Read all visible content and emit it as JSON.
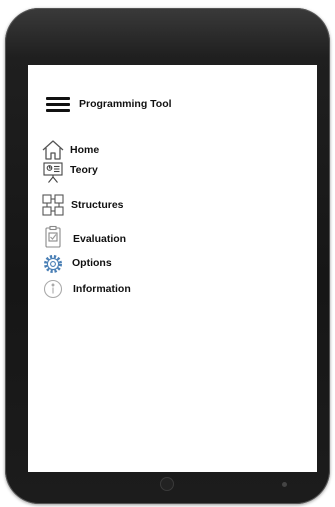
{
  "header": {
    "title": "Programming Tool"
  },
  "menu": {
    "items": [
      {
        "label": "Home",
        "icon": "home-icon"
      },
      {
        "label": "Teory",
        "icon": "presentation-board-icon"
      },
      {
        "label": "Structures",
        "icon": "structure-blocks-icon"
      },
      {
        "label": "Evaluation",
        "icon": "clipboard-check-icon"
      },
      {
        "label": "Options",
        "icon": "gear-icon"
      },
      {
        "label": "Information",
        "icon": "info-icon"
      }
    ]
  },
  "colors": {
    "device": "#1a1a1a",
    "screen": "#ffffff",
    "text": "#111111",
    "icon": "#555555"
  }
}
